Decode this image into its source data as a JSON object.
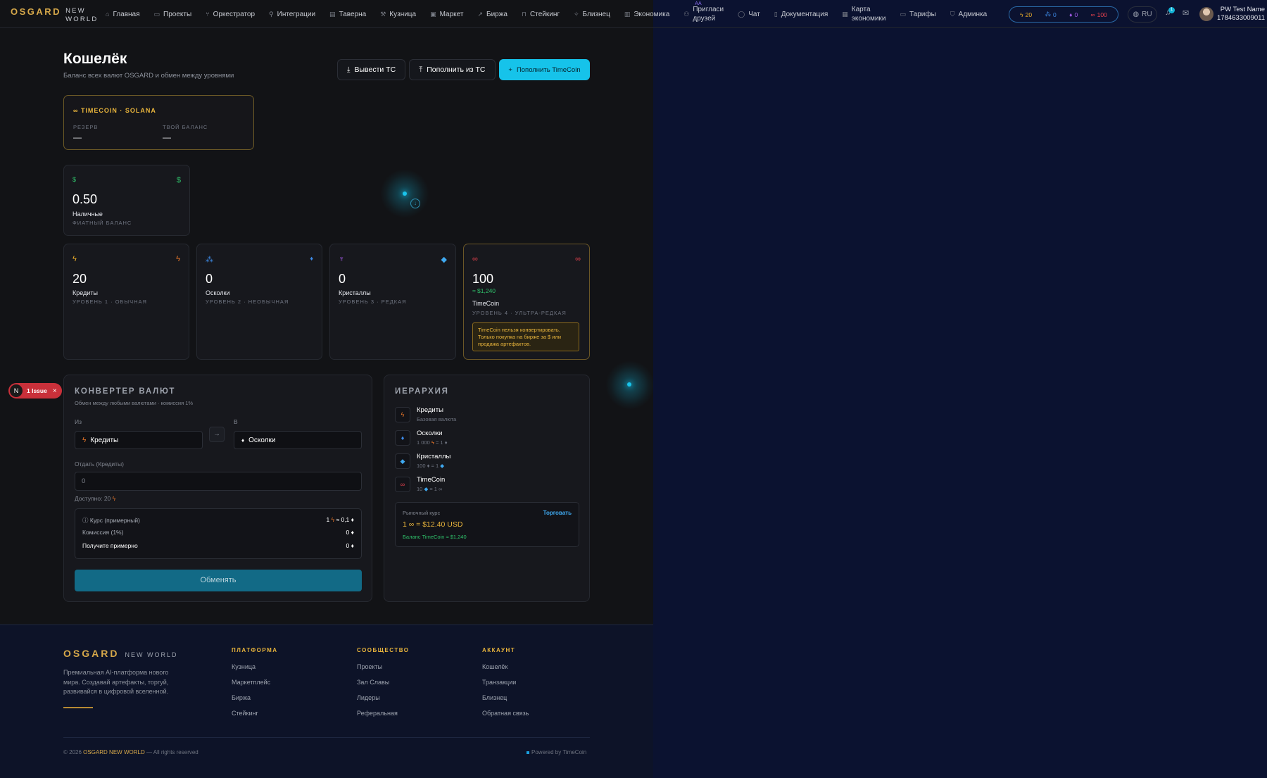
{
  "colors": {
    "accent": "#16c3ea",
    "gold": "#e9b53c",
    "credits": "#f07a2a",
    "shards": "#3d8be8",
    "crystals": "#a35be8",
    "timecoin": "#e8424f",
    "positive": "#2fc06a"
  },
  "brand": {
    "name": "OSGARD",
    "sub1": "NEW",
    "sub2": "WORLD"
  },
  "nav": {
    "items": [
      {
        "label": "Главная",
        "icon": "home-icon"
      },
      {
        "label": "Проекты",
        "icon": "folder-icon"
      },
      {
        "label": "Оркестратор",
        "icon": "flow-icon"
      },
      {
        "label": "Интеграции",
        "icon": "plug-icon"
      },
      {
        "label": "Таверна",
        "icon": "tavern-icon"
      },
      {
        "label": "Кузница",
        "icon": "hammer-icon"
      },
      {
        "label": "Маркет",
        "icon": "shop-icon"
      },
      {
        "label": "Биржа",
        "icon": "trend-icon"
      },
      {
        "label": "Стейкинг",
        "icon": "lock-icon"
      },
      {
        "label": "Близнец",
        "icon": "sparkle-icon"
      },
      {
        "label": "Экономика",
        "icon": "chart-icon"
      }
    ],
    "invite": {
      "line1": "Пригласи",
      "line2": "друзей",
      "badge": "AA"
    },
    "chat": "Чат",
    "docs": "Документация",
    "map": {
      "line1": "Карта",
      "line2": "экономики"
    },
    "tariffs": "Тарифы",
    "admin": "Админка"
  },
  "balances": {
    "credits": "20",
    "shards": "0",
    "crystals": "0",
    "timecoin": "100"
  },
  "lang": "RU",
  "notifications": "1",
  "user": {
    "name": "PW Test Name",
    "id": "1784633009011"
  },
  "header": {
    "title": "Кошелёк",
    "subtitle": "Баланс всех валют OSGARD и обмен между уровнями",
    "withdraw": "Вывести TC",
    "deposit_from": "Пополнить из TC",
    "top_up": "Пополнить TimeCoin"
  },
  "solana": {
    "title": "TIMECOIN · SOLANA",
    "reserve_label": "РЕЗЕРВ",
    "reserve_value": "—",
    "balance_label": "ТВОЙ БАЛАНС",
    "balance_value": "—"
  },
  "cash": {
    "value": "0.50",
    "name": "Наличные",
    "label": "ФИАТНЫЙ БАЛАНС"
  },
  "cards": [
    {
      "value": "20",
      "name": "Кредиты",
      "level": "УРОВЕНЬ 1 · ОБЫЧНАЯ"
    },
    {
      "value": "0",
      "name": "Осколки",
      "level": "УРОВЕНЬ 2 · НЕОБЫЧНАЯ"
    },
    {
      "value": "0",
      "name": "Кристаллы",
      "level": "УРОВЕНЬ 3 · РЕДКАЯ"
    },
    {
      "value": "100",
      "usd": "≈ $1,240",
      "name": "TimeCoin",
      "level": "УРОВЕНЬ 4 · УЛЬТРА-РЕДКАЯ",
      "note": "TimeCoin нельзя конвертировать. Только покупка на бирже за $ или продажа артефактов."
    }
  ],
  "issue": {
    "label": "1 Issue",
    "letter": "N"
  },
  "converter": {
    "title": "КОНВЕРТЕР ВАЛЮТ",
    "subtitle": "Обмен между любыми валютами · комиссия 1%",
    "from_label": "Из",
    "to_label": "В",
    "from": "Кредиты",
    "to": "Осколки",
    "give_label": "Отдать (Кредиты)",
    "placeholder": "0",
    "available": "Доступно: 20",
    "rate_label": "Курс (примерный)",
    "rate_value_a": "1",
    "rate_value_b": "≈ 0,1",
    "fee_label": "Комиссия (1%)",
    "fee_value": "0",
    "receive_label": "Получите примерно",
    "receive_value": "0",
    "button": "Обменять"
  },
  "hierarchy": {
    "title": "ИЕРАРХИЯ",
    "items": [
      {
        "name": "Кредиты",
        "sub": "Базовая валюта"
      },
      {
        "name": "Осколки",
        "sub_a": "1 000",
        "sub_b": "= 1"
      },
      {
        "name": "Кристаллы",
        "sub_a": "100",
        "sub_b": "= 1"
      },
      {
        "name": "TimeCoin",
        "sub_a": "10",
        "sub_b": "= 1"
      }
    ],
    "market": {
      "label": "Рыночный курс",
      "trade": "Торговать",
      "rate": "1 ∞ = $12.40 USD",
      "balance": "Баланс TimeCoin ≈ $1,240"
    }
  },
  "footer": {
    "brand": "OSGARD",
    "brand_sub": "NEW WORLD",
    "desc": "Премиальная AI-платформа нового мира. Создавай артефакты, торгуй, развивайся в цифровой вселенной.",
    "cols": [
      {
        "title": "ПЛАТФОРМА",
        "links": [
          "Кузница",
          "Маркетплейс",
          "Биржа",
          "Стейкинг"
        ]
      },
      {
        "title": "СООБЩЕСТВО",
        "links": [
          "Проекты",
          "Зал Славы",
          "Лидеры",
          "Реферальная"
        ]
      },
      {
        "title": "АККАУНТ",
        "links": [
          "Кошелёк",
          "Транзакции",
          "Близнец",
          "Обратная связь"
        ]
      }
    ],
    "copy_a": "© 2026",
    "copy_brand": "OSGARD NEW WORLD",
    "copy_b": "— All rights reserved",
    "powered": "Powered by TimeCoin"
  }
}
